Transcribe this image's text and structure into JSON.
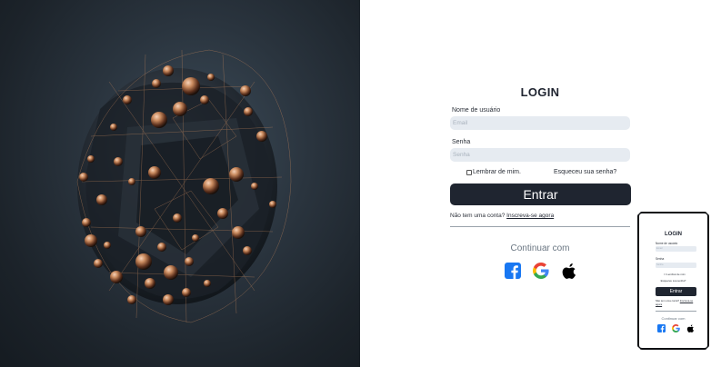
{
  "hero": {
    "icon": "abstract-3d-sphere-image"
  },
  "login": {
    "title": "LOGIN",
    "username_label": "Nome de usuário",
    "username_placeholder": "Email",
    "password_label": "Senha",
    "password_placeholder": "Senha",
    "remember_label": "Lembrar de mim.",
    "forgot_label": "Esqueceu sua senha?",
    "submit_label": "Entrar",
    "signup_text": "Não tem uma conta? ",
    "signup_link": "Inscreva-se agora",
    "continue_with": "Continuar com",
    "socials": [
      {
        "name": "facebook",
        "icon": "facebook-icon",
        "color": "#1877f2"
      },
      {
        "name": "google",
        "icon": "google-icon",
        "color": "#4285f4"
      },
      {
        "name": "apple",
        "icon": "apple-icon",
        "color": "#000000"
      }
    ]
  },
  "mobile_preview": {
    "title": "LOGIN",
    "username_label": "Nome de usuário",
    "username_placeholder": "Email",
    "password_label": "Senha",
    "password_placeholder": "Senha",
    "remember_label": "Lembrar de mim",
    "forgot_label": "Esqueceu sua senha?",
    "submit_label": "Entrar",
    "signup_text": "Não tem uma conta? ",
    "signup_link": "Inscreva-se agora",
    "continue_with": "Continuar com"
  },
  "colors": {
    "primary_button": "#1f2530",
    "field_bg": "#e6ebf1",
    "accent_copper": "#c98a5e"
  }
}
